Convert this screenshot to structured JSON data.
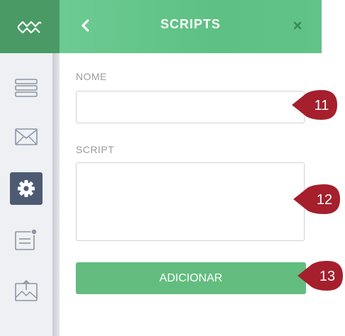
{
  "header": {
    "title": "SCRIPTS"
  },
  "sidebar": {
    "logo_icon": "wave-logo-icon",
    "items": [
      {
        "icon": "list-icon",
        "active": false
      },
      {
        "icon": "mail-icon",
        "active": false
      },
      {
        "icon": "gear-icon",
        "active": true
      },
      {
        "icon": "form-icon",
        "active": false
      },
      {
        "icon": "image-upload-icon",
        "active": false
      }
    ]
  },
  "form": {
    "name_label": "NOME",
    "name_value": "",
    "script_label": "SCRIPT",
    "script_value": "",
    "submit_label": "ADICIONAR"
  },
  "callouts": [
    "11",
    "12",
    "13"
  ],
  "colors": {
    "accent_green": "#5ec082",
    "button_green": "#63bd7f",
    "sidebar_active": "#4d5a72",
    "callout_red": "#a51f2d"
  }
}
